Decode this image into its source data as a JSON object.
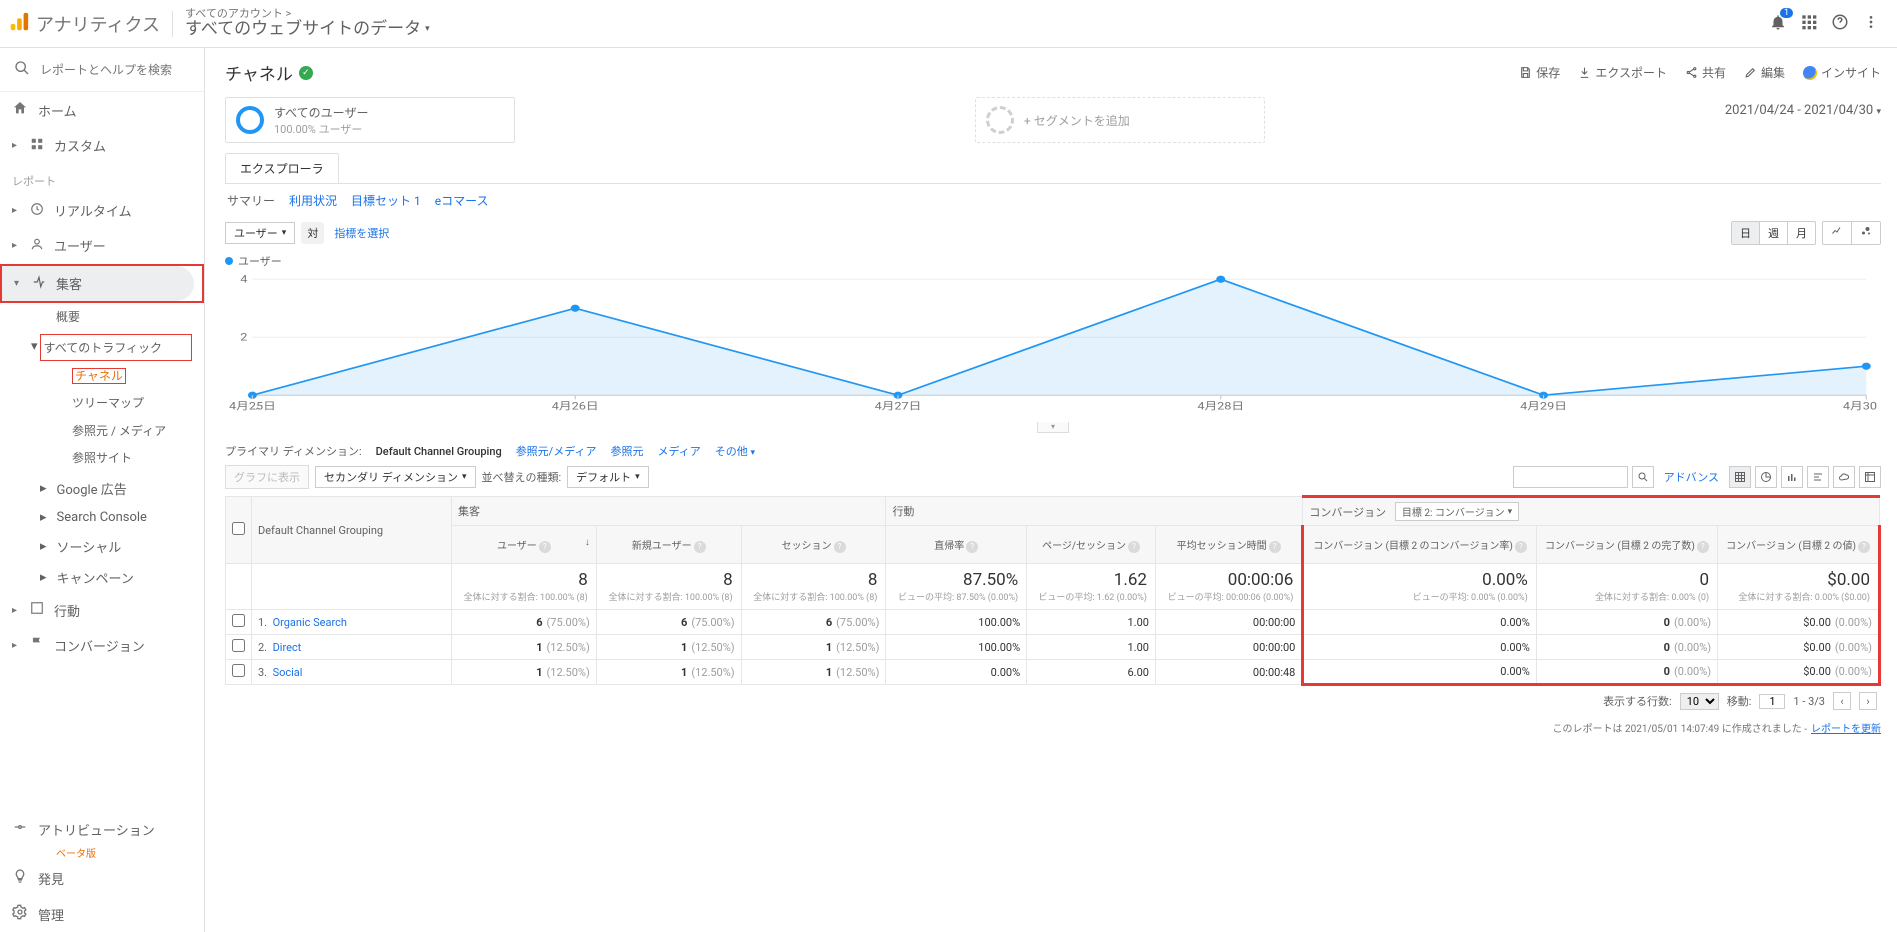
{
  "header": {
    "product_name": "アナリティクス",
    "account_line1": "すべてのアカウント >",
    "account_line2": "すべてのウェブサイトのデータ",
    "notif_count": "1",
    "actions": {
      "save": "保存",
      "export": "エクスポート",
      "share": "共有",
      "edit": "編集",
      "insight": "インサイト"
    }
  },
  "sidebar": {
    "search_placeholder": "レポートとヘルプを検索",
    "home": "ホーム",
    "custom": "カスタム",
    "reports_label": "レポート",
    "realtime": "リアルタイム",
    "user": "ユーザー",
    "acquisition": "集客",
    "acq": {
      "overview": "概要",
      "all_traffic": "すべてのトラフィック",
      "channel": "チャネル",
      "treemap": "ツリーマップ",
      "source_medium": "参照元 / メディア",
      "referrals": "参照サイト",
      "google_ads": "Google 広告",
      "search_console": "Search Console",
      "social": "ソーシャル",
      "campaigns": "キャンペーン"
    },
    "behavior": "行動",
    "conversion": "コンバージョン",
    "attribution": "アトリビューション",
    "attribution_beta": "ベータ版",
    "discover": "発見",
    "admin": "管理"
  },
  "page": {
    "title": "チャネル",
    "seg_all_users": "すべてのユーザー",
    "seg_all_users_sub": "100.00% ユーザー",
    "seg_add": "+ セグメントを追加",
    "date_range": "2021/04/24 - 2021/04/30",
    "explorer_tab": "エクスプローラ",
    "sub_tabs": {
      "summary": "サマリー",
      "usage": "利用状況",
      "goalset": "目標セット 1",
      "ecommerce": "eコマース"
    },
    "user_sel": "ユーザー",
    "vs": "対",
    "metric_link": "指標を選択",
    "period": {
      "day": "日",
      "week": "週",
      "month": "月"
    },
    "legend": "ユーザー"
  },
  "chart_data": {
    "type": "line",
    "title": "",
    "xlabel": "",
    "ylabel": "",
    "ylim": [
      0,
      4
    ],
    "yticks": [
      2,
      4
    ],
    "categories": [
      "4月25日",
      "4月26日",
      "4月27日",
      "4月28日",
      "4月29日",
      "4月30日"
    ],
    "series": [
      {
        "name": "ユーザー",
        "values": [
          0,
          3,
          0,
          4,
          0,
          1
        ]
      }
    ]
  },
  "dim_toolbar": {
    "primary_label": "プライマリ ディメンション:",
    "default_grouping": "Default Channel Grouping",
    "source_medium": "参照元/メディア",
    "source": "参照元",
    "medium": "メディア",
    "other": "その他",
    "graph_btn": "グラフに表示",
    "secondary": "セカンダリ ディメンション",
    "sort_label": "並べ替えの種類:",
    "sort_default": "デフォルト",
    "advance": "アドバンス"
  },
  "table": {
    "groups": {
      "acquisition": "集客",
      "behavior": "行動",
      "conversion": "コンバージョン",
      "goal_sel": "目標 2: コンバージョン"
    },
    "cols": {
      "dcg": "Default Channel Grouping",
      "users": "ユーザー",
      "new_users": "新規ユーザー",
      "sessions": "セッション",
      "bounce": "直帰率",
      "pps": "ページ/セッション",
      "avg_dur": "平均セッション時間",
      "conv_rate": "コンバージョン (目標 2 のコンバージョン率)",
      "conv_comp": "コンバージョン (目標 2 の完了数)",
      "conv_val": "コンバージョン (目標 2 の値)"
    },
    "summary": {
      "users": {
        "big": "8",
        "small": "全体に対する割合: 100.00% (8)"
      },
      "new_users": {
        "big": "8",
        "small": "全体に対する割合: 100.00% (8)"
      },
      "sessions": {
        "big": "8",
        "small": "全体に対する割合: 100.00% (8)"
      },
      "bounce": {
        "big": "87.50%",
        "small": "ビューの平均: 87.50% (0.00%)"
      },
      "pps": {
        "big": "1.62",
        "small": "ビューの平均: 1.62 (0.00%)"
      },
      "avg_dur": {
        "big": "00:00:06",
        "small": "ビューの平均: 00:00:06 (0.00%)"
      },
      "conv_rate": {
        "big": "0.00%",
        "small": "ビューの平均: 0.00% (0.00%)"
      },
      "conv_comp": {
        "big": "0",
        "small": "全体に対する割合: 0.00% (0)"
      },
      "conv_val": {
        "big": "$0.00",
        "small": "全体に対する割合: 0.00% ($0.00)"
      }
    },
    "rows": [
      {
        "idx": "1.",
        "name": "Organic Search",
        "users": "6",
        "users_pct": "(75.00%)",
        "nu": "6",
        "nu_pct": "(75.00%)",
        "sess": "6",
        "sess_pct": "(75.00%)",
        "bounce": "100.00%",
        "pps": "1.00",
        "dur": "00:00:00",
        "cr": "0.00%",
        "cc": "0",
        "cc_pct": "(0.00%)",
        "cv": "$0.00",
        "cv_pct": "(0.00%)"
      },
      {
        "idx": "2.",
        "name": "Direct",
        "users": "1",
        "users_pct": "(12.50%)",
        "nu": "1",
        "nu_pct": "(12.50%)",
        "sess": "1",
        "sess_pct": "(12.50%)",
        "bounce": "100.00%",
        "pps": "1.00",
        "dur": "00:00:00",
        "cr": "0.00%",
        "cc": "0",
        "cc_pct": "(0.00%)",
        "cv": "$0.00",
        "cv_pct": "(0.00%)"
      },
      {
        "idx": "3.",
        "name": "Social",
        "users": "1",
        "users_pct": "(12.50%)",
        "nu": "1",
        "nu_pct": "(12.50%)",
        "sess": "1",
        "sess_pct": "(12.50%)",
        "bounce": "0.00%",
        "pps": "6.00",
        "dur": "00:00:48",
        "cr": "0.00%",
        "cc": "0",
        "cc_pct": "(0.00%)",
        "cv": "$0.00",
        "cv_pct": "(0.00%)"
      }
    ]
  },
  "footer": {
    "rows_label": "表示する行数:",
    "rows_val": "10",
    "move_label": "移動:",
    "move_val": "1",
    "range": "1 - 3/3",
    "note_pre": "このレポートは 2021/05/01 14:07:49 に作成されました -",
    "note_link": "レポートを更新"
  }
}
